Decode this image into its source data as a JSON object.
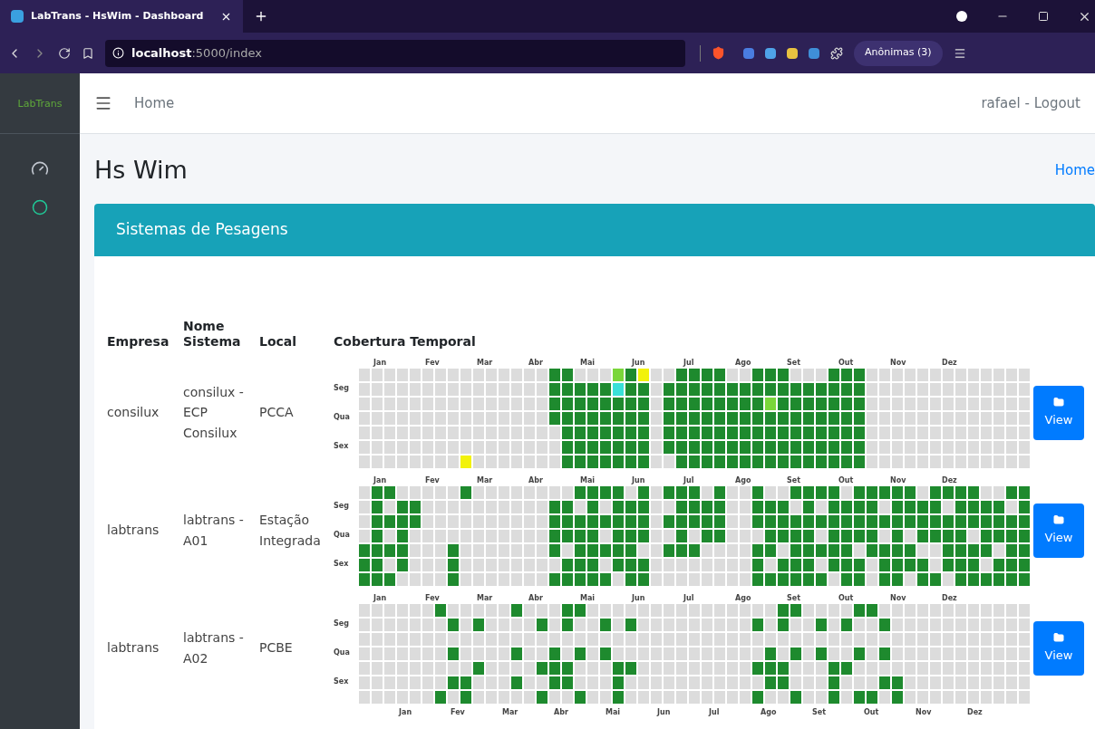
{
  "browser": {
    "tab_title": "LabTrans - HsWim - Dashboard",
    "address_host": "localhost",
    "address_path": ":5000/index",
    "profile": "Anônimas (3)"
  },
  "sidebar": {
    "logo": "LabTrans"
  },
  "navbar": {
    "link": "Home",
    "user": "rafael - Logout"
  },
  "page": {
    "title": "Hs Wim",
    "breadcrumb": "Home"
  },
  "card": {
    "title": "Sistemas de Pesagens",
    "columns": [
      "Empresa",
      "Nome Sistema",
      "Local",
      "Cobertura Temporal"
    ],
    "rows": [
      {
        "empresa": "consilux",
        "nome": "consilux - ECP Consilux",
        "local": "PCCA",
        "months": [
          "Jan",
          "Fev",
          "Mar",
          "Abr",
          "Mai",
          "Jun",
          "Jul",
          "Ago",
          "Set",
          "Out",
          "Nov",
          "Dez"
        ],
        "weekdays": [
          "Seg",
          "Qua",
          "Sex"
        ],
        "button": "View"
      },
      {
        "empresa": "labtrans",
        "nome": "labtrans - A01",
        "local": "Estação Integrada",
        "months": [
          "Jan",
          "Fev",
          "Mar",
          "Abr",
          "Mai",
          "Jun",
          "Jul",
          "Ago",
          "Set",
          "Out",
          "Nov",
          "Dez"
        ],
        "weekdays": [
          "Seg",
          "Qua",
          "Sex"
        ],
        "button": "View"
      },
      {
        "empresa": "labtrans",
        "nome": "labtrans - A02",
        "local": "PCBE",
        "months": [
          "Jan",
          "Fev",
          "Mar",
          "Abr",
          "Mai",
          "Jun",
          "Jul",
          "Ago",
          "Set",
          "Out",
          "Nov",
          "Dez"
        ],
        "weekdays": [
          "Seg",
          "Qua",
          "Sex"
        ],
        "button": "View"
      }
    ],
    "next_row_months": [
      "Jan",
      "Fev",
      "Mar",
      "Abr",
      "Mai",
      "Jun",
      "Jul",
      "Ago",
      "Set",
      "Out",
      "Nov",
      "Dez"
    ]
  }
}
